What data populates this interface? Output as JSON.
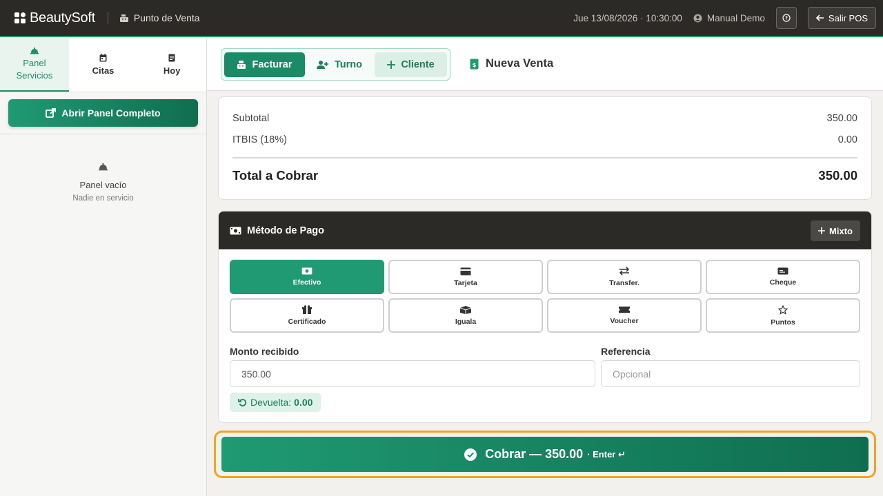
{
  "topbar": {
    "brand": "BeautySoft",
    "module": "Punto de Venta",
    "datetime": "Jue 13/08/2026 · 10:30:00",
    "user": "Manual Demo",
    "help_icon": "question-icon",
    "exit_label": "Salir POS"
  },
  "sidebar": {
    "tabs": [
      {
        "label": "Panel Servicios",
        "icon": "service-bell-icon",
        "active": true
      },
      {
        "label": "Citas",
        "icon": "calendar-icon",
        "active": false
      },
      {
        "label": "Hoy",
        "icon": "document-icon",
        "active": false
      }
    ],
    "open_panel_label": "Abrir Panel Completo",
    "empty_title": "Panel vacío",
    "empty_subtitle": "Nadie en servicio"
  },
  "header": {
    "modes": [
      {
        "label": "Facturar",
        "icon": "cash-register-icon",
        "active": true
      },
      {
        "label": "Turno",
        "icon": "user-plus-icon",
        "active": false
      },
      {
        "label": "Cliente",
        "icon": "plus-icon",
        "active": false
      }
    ],
    "sale_title": "Nueva Venta"
  },
  "totals": {
    "subtotal_label": "Subtotal",
    "subtotal_value": "350.00",
    "tax_label": "ITBIS (18%)",
    "tax_value": "0.00",
    "total_label": "Total a Cobrar",
    "total_value": "350.00"
  },
  "payment": {
    "title": "Método de Pago",
    "mixto_label": "Mixto",
    "methods": [
      {
        "label": "Efectivo",
        "icon": "cash-icon",
        "active": true
      },
      {
        "label": "Tarjeta",
        "icon": "credit-card-icon",
        "active": false
      },
      {
        "label": "Transfer.",
        "icon": "transfer-icon",
        "active": false
      },
      {
        "label": "Cheque",
        "icon": "cheque-icon",
        "active": false
      },
      {
        "label": "Certificado",
        "icon": "gift-icon",
        "active": false
      },
      {
        "label": "Iguala",
        "icon": "box-icon",
        "active": false
      },
      {
        "label": "Voucher",
        "icon": "ticket-icon",
        "active": false
      },
      {
        "label": "Puntos",
        "icon": "star-icon",
        "active": false
      }
    ],
    "amount_label": "Monto recibido",
    "amount_value": "350.00",
    "reference_label": "Referencia",
    "reference_placeholder": "Opcional",
    "change_label": "Devuelta:",
    "change_value": "0.00"
  },
  "charge": {
    "label": "Cobrar — 350.00",
    "shortcut": "· Enter ↵"
  },
  "colors": {
    "accent": "#1f9a72",
    "dark": "#2b2a27",
    "focus_ring": "#f0a520"
  }
}
